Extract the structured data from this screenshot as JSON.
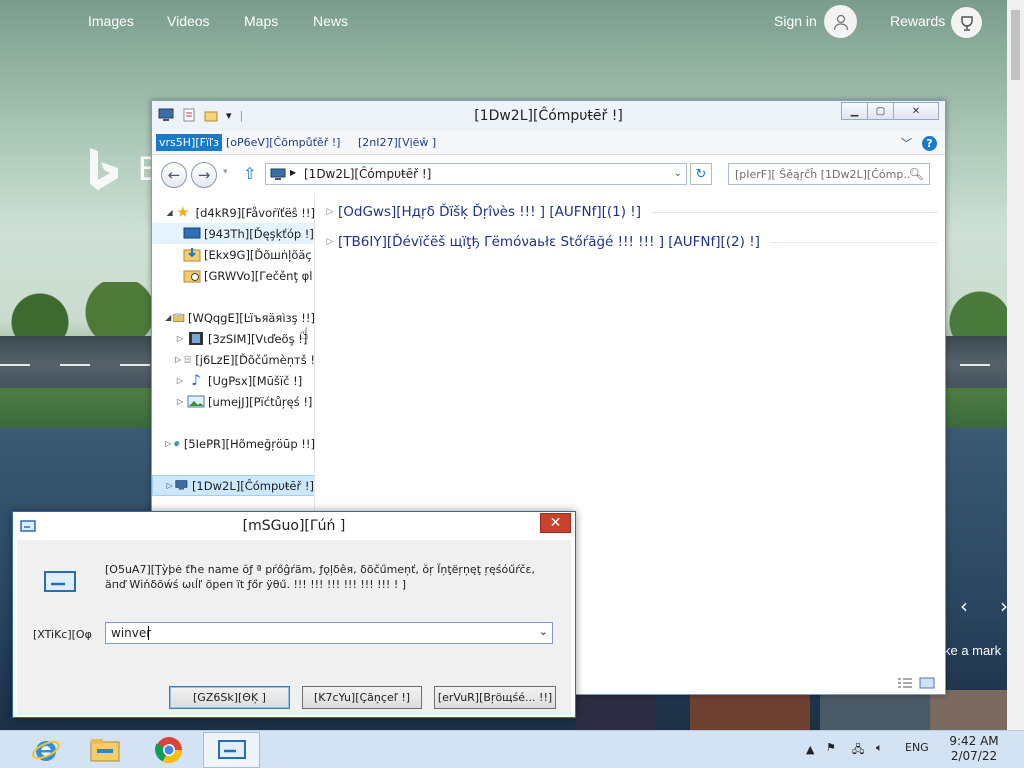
{
  "bing": {
    "nav": [
      "Images",
      "Videos",
      "Maps",
      "News"
    ],
    "signin": "Sign in",
    "rewards": "Rewards",
    "logo_letter": "b",
    "logo_text": "B",
    "make_mark": "ke a mark"
  },
  "explorer": {
    "title": "[1Dw2L][Ĉómpυŧēř !]",
    "tabs": {
      "file": "vrs5H][Fïľз",
      "computer": "[oP6eV][Ĉõmpůťěř !]",
      "view": "[2nI27][Vịëŵ ]"
    },
    "address": "[1Dw2L][Ĉómpυŧēř !]",
    "search_placeholder": "[pIerF][ Ŝěąŗĉĥ [1Dw2L][Ĉómp...",
    "nav_items": [
      {
        "label": "[d4kR9][Fåvoṙїťëŝ !!]"
      },
      {
        "label": "[943Th][Ďęşķťóp !]"
      },
      {
        "label": "[Ekx9G][Ďõшṅļõäç"
      },
      {
        "label": "[GRWVo][Γеčěnţ φl"
      },
      {
        "label": "[WQqgE][Ŀïъяäяìзş !!]"
      },
      {
        "label": "[3zSIM][Vιďеõş !]"
      },
      {
        "label": "[j6LzE][Ďõčűmèņтš !"
      },
      {
        "label": "[UgPsx][Mūšïč !]"
      },
      {
        "label": "[umejJ][Pïćtůŗęś !]"
      },
      {
        "label": "[5IePR][Hõmeğŗöūp !!]"
      },
      {
        "label": "[1Dw2L][Ĉómpυŧēř !]"
      }
    ],
    "groups": [
      {
        "label": "[OdGws][Hдŗδ Ďïšķ Ďŗîνès !!! ] [AUFNf][(1) !]"
      },
      {
        "label": "[TB6IY][Ďévïčёš щïţђ Γёmóνаьłε Stőŕãğé !!! !!! ] [AUFNf][(2) !]"
      }
    ]
  },
  "run": {
    "title": "[mSGuo][Γúń ]",
    "message": "[O5uA7][Ţỳþė ťħe name ŏƒ ª pŕőĝŕãm, ƒǫļδêя, δõčűmеņť, ŏŗ Ïņţëŗņęţ ŗęśóűŕčε, äпď Wіńδõẃś ωιĺľ õpеп ït ƒőr ÿθű. !!! !!! !!! !!! !!! !!! ! ]",
    "open_label": "[XTiKc][Οφ",
    "input_value": "winver",
    "buttons": {
      "ok": "[GZ6Sk][ΘĶ ]",
      "cancel": "[K7cYu][Çãņçеľ !]",
      "browse": "[erVuR][Bŗöщśé... !!]"
    }
  },
  "taskbar": {
    "lang": "ENG",
    "time": "9:42 AM",
    "date": "2/07/22"
  }
}
